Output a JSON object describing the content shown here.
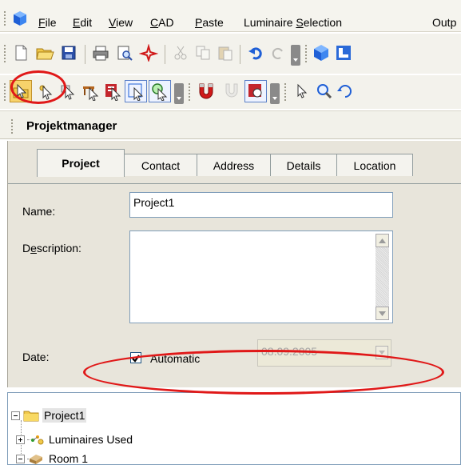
{
  "menubar": {
    "items": [
      "File",
      "Edit",
      "View",
      "CAD",
      "Paste",
      "Luminaire Selection",
      "Outp"
    ],
    "mnemonics": [
      "F",
      "E",
      "V",
      "C",
      "P",
      "S",
      ""
    ]
  },
  "toolbar1": {
    "icons": [
      "new-document-icon",
      "open-folder-icon",
      "save-icon",
      "print-icon",
      "print-preview-icon",
      "pdf-icon",
      "cut-icon",
      "copy-icon",
      "paste-icon",
      "undo-icon",
      "redo-icon",
      "more-icon",
      "cube-icon",
      "room-icon"
    ]
  },
  "toolbar2": {
    "icons": [
      "project-manager-icon",
      "luminaire-select-icon",
      "selection-icon",
      "table-select-icon",
      "report-select-icon",
      "window-select-icon",
      "zoom-select-icon",
      "magnet-icon",
      "dxf-icon",
      "calc-icon",
      "pointer-icon",
      "zoom-icon",
      "rotate-icon"
    ]
  },
  "panel": {
    "title": "Projektmanager"
  },
  "tabs": [
    {
      "label": "Project",
      "active": true
    },
    {
      "label": "Contact",
      "active": false
    },
    {
      "label": "Address",
      "active": false
    },
    {
      "label": "Details",
      "active": false
    },
    {
      "label": "Location",
      "active": false
    }
  ],
  "form": {
    "name_label": "Name:",
    "name_value": "Project1",
    "description_label": "Description:",
    "description_mnemonic": "e",
    "description_value": "",
    "date_label": "Date:",
    "automatic_label": "Automatic",
    "automatic_checked": true,
    "date_value": "08.09.2005"
  },
  "tree": {
    "nodes": [
      {
        "label": "Project1",
        "icon": "folder-icon",
        "expanded": true,
        "level": 0
      },
      {
        "label": "Luminaires Used",
        "icon": "luminaires-icon",
        "expanded": false,
        "level": 1
      },
      {
        "label": "Room 1",
        "icon": "room-icon",
        "expanded": true,
        "level": 1
      }
    ]
  },
  "annotations": {
    "color": "#e01818"
  },
  "colors": {
    "accent_blue": "#1f5fd6",
    "highlight_yellow": "#f5d66b"
  }
}
